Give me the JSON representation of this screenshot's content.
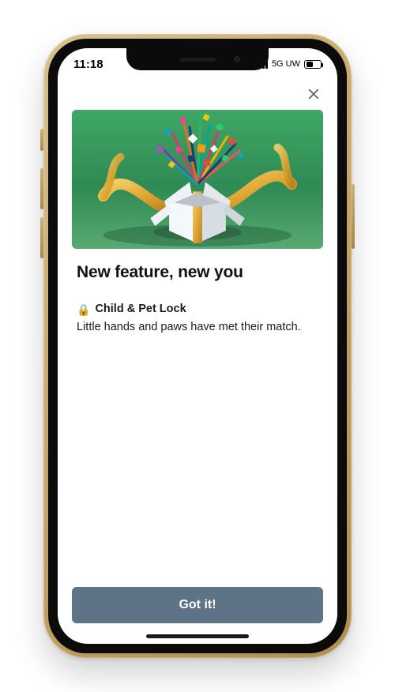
{
  "status": {
    "time": "11:18",
    "network_label": "5G UW"
  },
  "modal": {
    "title": "New feature, new you",
    "feature": {
      "icon": "🔒",
      "name": "Child & Pet Lock",
      "description": "Little hands and paws have met their match."
    },
    "cta_label": "Got it!"
  }
}
